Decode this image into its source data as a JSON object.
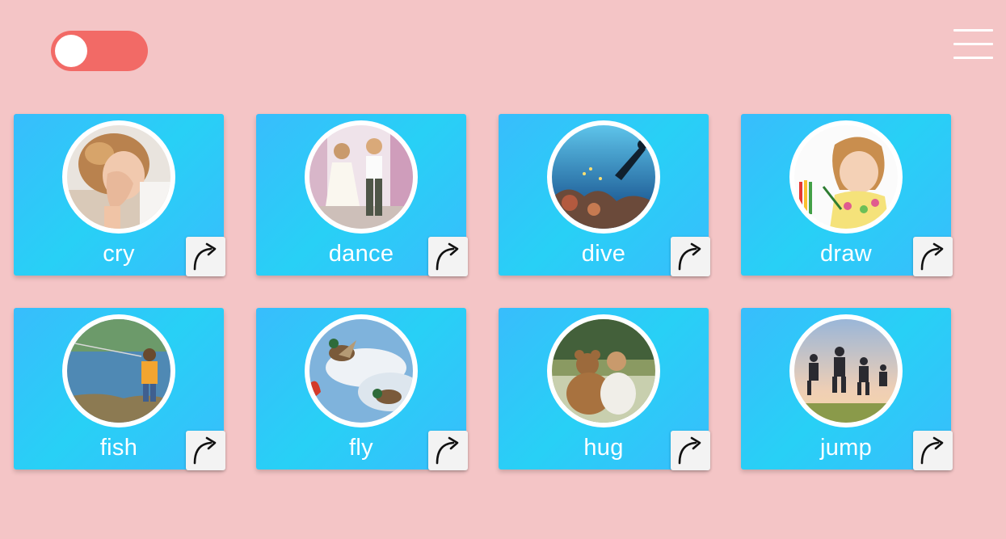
{
  "colors": {
    "background": "#f4c5c6",
    "toggle_track": "#f26a66",
    "card_gradient_start": "#38bdfc",
    "card_gradient_mid": "#28d0f6",
    "card_text": "#ffffff"
  },
  "toggle": {
    "state": "off",
    "icon": "toggle-switch"
  },
  "menu": {
    "icon": "hamburger-menu-icon"
  },
  "cards": [
    {
      "word": "cry",
      "image": "child-crying-photo",
      "action_icon": "forward-arrow-icon"
    },
    {
      "word": "dance",
      "image": "children-dancing-photo",
      "action_icon": "forward-arrow-icon"
    },
    {
      "word": "dive",
      "image": "underwater-diver-photo",
      "action_icon": "forward-arrow-icon"
    },
    {
      "word": "draw",
      "image": "girl-drawing-photo",
      "action_icon": "forward-arrow-icon"
    },
    {
      "word": "fish",
      "image": "boy-fishing-photo",
      "action_icon": "forward-arrow-icon"
    },
    {
      "word": "fly",
      "image": "ducks-flying-photo",
      "action_icon": "forward-arrow-icon"
    },
    {
      "word": "hug",
      "image": "child-hugging-teddy-photo",
      "action_icon": "forward-arrow-icon"
    },
    {
      "word": "jump",
      "image": "kids-jumping-photo",
      "action_icon": "forward-arrow-icon"
    }
  ]
}
